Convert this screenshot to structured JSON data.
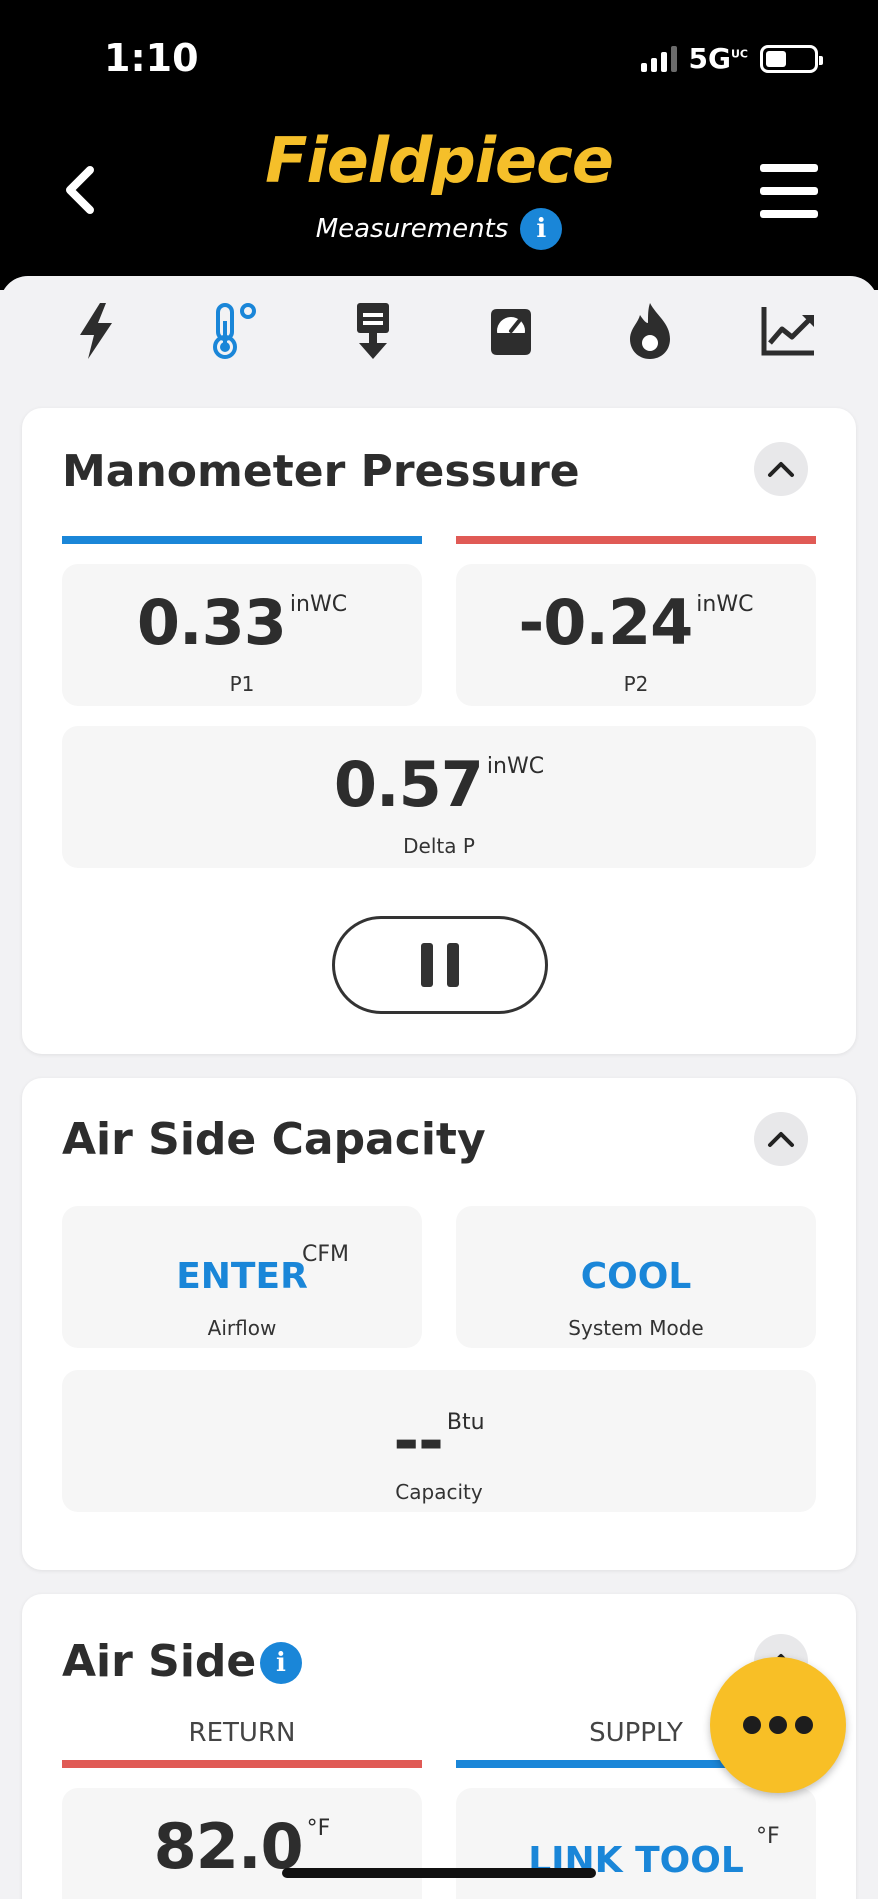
{
  "status": {
    "time": "1:10",
    "network": "5G",
    "network_sup": "UC"
  },
  "header": {
    "logo": "Fieldpiece",
    "subtitle": "Measurements"
  },
  "tabs": [
    {
      "icon": "lightning-icon",
      "active": false
    },
    {
      "icon": "thermometer-icon",
      "active": true
    },
    {
      "icon": "download-icon",
      "active": false
    },
    {
      "icon": "gauge-icon",
      "active": false
    },
    {
      "icon": "flame-icon",
      "active": false
    },
    {
      "icon": "chart-icon",
      "active": false
    }
  ],
  "manometer": {
    "title": "Manometer Pressure",
    "p1": {
      "value": "0.33",
      "unit": "inWC",
      "label": "P1"
    },
    "p2": {
      "value": "-0.24",
      "unit": "inWC",
      "label": "P2"
    },
    "delta": {
      "value": "0.57",
      "unit": "inWC",
      "label": "Delta P"
    }
  },
  "capacity": {
    "title": "Air Side Capacity",
    "airflow": {
      "value": "ENTER",
      "unit": "CFM",
      "label": "Airflow"
    },
    "mode": {
      "value": "COOL",
      "label": "System Mode"
    },
    "capacity": {
      "value": "--",
      "unit": "Btu",
      "label": "Capacity"
    }
  },
  "airside": {
    "title": "Air Side",
    "return_label": "RETURN",
    "supply_label": "SUPPLY",
    "return_value": "82.0",
    "return_unit": "°F",
    "supply_value": "LINK TOOL",
    "supply_unit": "°F"
  },
  "colors": {
    "accent": "#1a86d8",
    "brand": "#f5bf2a",
    "red": "#e05a55",
    "fab": "#f8bf26"
  }
}
